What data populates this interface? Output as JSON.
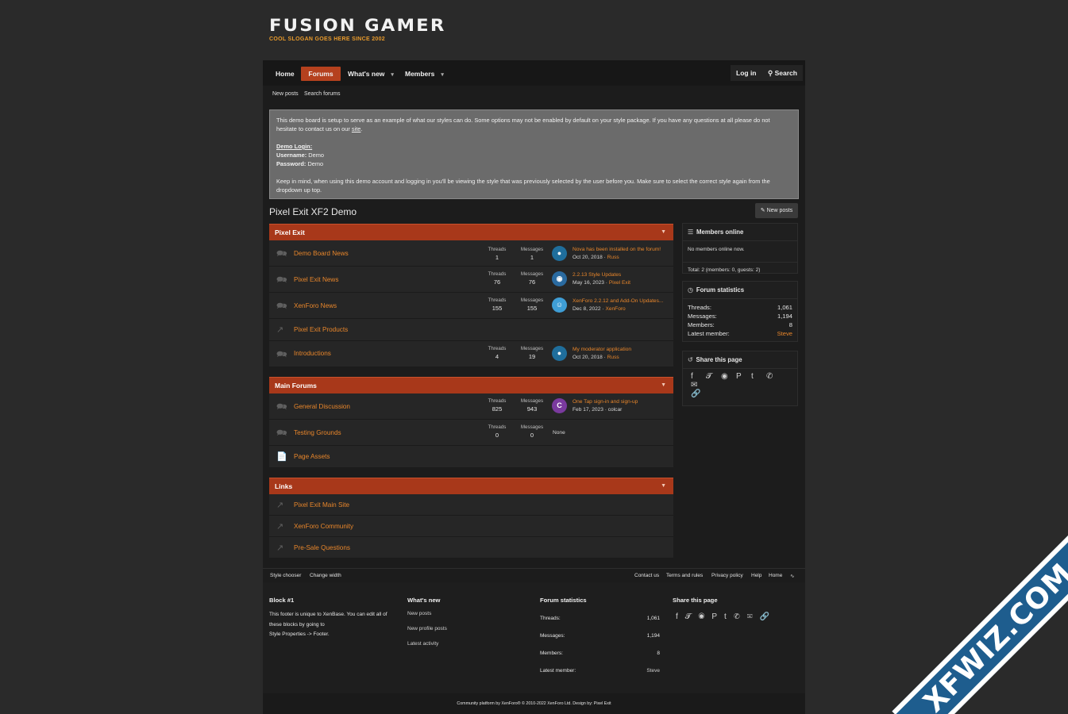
{
  "site": {
    "title": "FUSION GAMER",
    "slogan": "COOL SLOGAN GOES HERE SINCE 2002"
  },
  "nav": {
    "tabs": [
      {
        "label": "Home"
      },
      {
        "label": "Forums"
      },
      {
        "label": "What's new"
      },
      {
        "label": "Members"
      }
    ],
    "login": "Log in",
    "search": "Search",
    "caret": "▾"
  },
  "subnav": {
    "new_posts": "New posts",
    "search_forums": "Search forums"
  },
  "notice": {
    "line1": "This demo board is setup to serve as an example of what our styles can do. Some options may not be enabled by default on your style package. If you have any questions at all please do not hesitate to contact us on our ",
    "site_link": "site",
    "period": ".",
    "demo_login": "Demo Login:",
    "username_label": "Username:",
    "username": " Demo",
    "password_label": "Password:",
    "password": " Demo",
    "line3": "Keep in mind, when using this demo account and logging in you'll be viewing the style that was previously selected by the user before you. Make sure to select the correct style again from the dropdown up top."
  },
  "page": {
    "title": "Pixel Exit XF2 Demo",
    "new_posts": "New posts"
  },
  "labels": {
    "threads": "Threads",
    "messages": "Messages",
    "none": "None",
    "separator": " · "
  },
  "categories": [
    {
      "title": "Pixel Exit",
      "nodes": [
        {
          "title": "Demo Board News",
          "threads": "1",
          "messages": "1",
          "last_title": "Nova has been installed on the forum!",
          "last_date": "Oct 20, 2018",
          "last_user": "Russ"
        },
        {
          "title": "Pixel Exit News",
          "threads": "76",
          "messages": "76",
          "last_title": "2.2.13 Style Updates",
          "last_date": "May 16, 2023",
          "last_user": "Pixel Exit"
        },
        {
          "title": "XenForo News",
          "threads": "155",
          "messages": "155",
          "last_title": "XenForo 2.2.12 and Add-On Updates...",
          "last_date": "Dec 8, 2022",
          "last_user": "XenForo"
        },
        {
          "title": "Pixel Exit Products"
        },
        {
          "title": "Introductions",
          "threads": "4",
          "messages": "19",
          "last_title": "My moderator application",
          "last_date": "Oct 20, 2018",
          "last_user": "Russ"
        }
      ]
    },
    {
      "title": "Main Forums",
      "nodes": [
        {
          "title": "General Discussion",
          "threads": "825",
          "messages": "943",
          "last_title": "One Tap sign-in and sign-up",
          "last_date": "Feb 17, 2023",
          "last_user": "colcar",
          "avatar_letter": "C"
        },
        {
          "title": "Testing Grounds",
          "threads": "0",
          "messages": "0"
        },
        {
          "title": "Page Assets"
        }
      ]
    },
    {
      "title": "Links",
      "nodes": [
        {
          "title": "Pixel Exit Main Site"
        },
        {
          "title": "XenForo Community"
        },
        {
          "title": "Pre-Sale Questions"
        }
      ]
    }
  ],
  "sidebar": {
    "members_online": {
      "title": "Members online",
      "empty": "No members online now.",
      "total": "Total: 2 (members: 0, guests: 2)"
    },
    "forum_stats": {
      "title": "Forum statistics",
      "threads_label": "Threads:",
      "threads": "1,061",
      "messages_label": "Messages:",
      "messages": "1,194",
      "members_label": "Members:",
      "members": "8",
      "latest_label": "Latest member:",
      "latest": "Steve"
    },
    "share": {
      "title": "Share this page"
    }
  },
  "footer_bar": {
    "style_chooser": "Style chooser",
    "change_width": "Change width",
    "contact": "Contact us",
    "terms": "Terms and rules",
    "privacy": "Privacy policy",
    "help": "Help",
    "home": "Home"
  },
  "footer": {
    "block1": {
      "title": "Block #1",
      "line1": "This footer is unique to XenBase. You can edit all of",
      "line2": "these blocks by going to",
      "line3": "Style Properties -> Footer."
    },
    "whats_new": {
      "title": "What's new",
      "links": [
        "New posts",
        "New profile posts",
        "Latest activity"
      ]
    },
    "stats": {
      "title": "Forum statistics",
      "threads_label": "Threads:",
      "threads": "1,061",
      "messages_label": "Messages:",
      "messages": "1,194",
      "members_label": "Members:",
      "members": "8",
      "latest_label": "Latest member:",
      "latest": "Steve"
    },
    "share": {
      "title": "Share this page"
    },
    "copyright": "Community platform by XenForo® © 2010-2022 XenForo Ltd. Design by: Pixel Exit"
  },
  "watermark": "XFWIZ.COM",
  "colors": {
    "accent": "#a8381a",
    "link": "#e8862b",
    "bg": "#2a2a2a",
    "watermark": "#1e5d8e"
  }
}
